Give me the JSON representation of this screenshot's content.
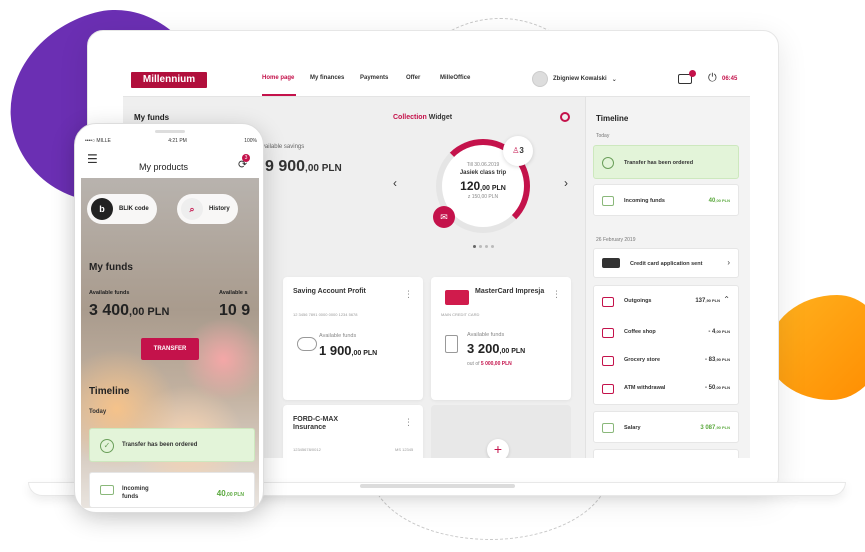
{
  "brand": {
    "logo_text": "Millennium",
    "accent": "#c4124b"
  },
  "topnav": {
    "items": [
      "Home page",
      "My finances",
      "Payments",
      "Offer",
      "MilleOffice"
    ],
    "user_name": "Zbigniew Kowalski",
    "mail_badge": "",
    "time": "06:45"
  },
  "funds": {
    "title": "My funds",
    "available_label": "Available savings",
    "available_value": "9 900",
    "available_decimals": ",00 PLN"
  },
  "widget": {
    "title_accent": "Collection",
    "title_rest": " Widget",
    "date": "Till 30.06.2019",
    "name": "Jasiek class trip",
    "amount": "120",
    "amount_decimals": ",00 PLN",
    "goal": "z 150,00 PLN",
    "participants": "3"
  },
  "cards": [
    {
      "title": "Saving Account Profit",
      "sub": "12 3456 7891 0000 0000 1234 5678",
      "funds_label": "Available funds",
      "value": "1 900",
      "decimals": ",00 PLN"
    },
    {
      "title": "MasterCard Impresja",
      "sub": "MAIN CREDIT CARD",
      "funds_label": "Available funds",
      "value": "3 200",
      "decimals": ",00 PLN",
      "out_of_label": "out of",
      "out_of": "5 000,00 PLN"
    },
    {
      "title": "FORD-C-MAX Insurance",
      "sub": "12345678/0012",
      "sub2": "MS 12345"
    }
  ],
  "timeline": {
    "title": "Timeline",
    "today": "Today",
    "date2": "26 February 2019",
    "items": [
      {
        "text": "Transfer has been ordered"
      },
      {
        "text": "Incoming funds",
        "amount": "40",
        "decimals": ",00 PLN"
      },
      {
        "text": "Credit card application sent"
      },
      {
        "text": "Outgoings",
        "amount": "137",
        "decimals": ",90 PLN"
      },
      {
        "text": "Coffee shop",
        "amount": "- 4",
        "decimals": ",00 PLN"
      },
      {
        "text": "Grocery store",
        "amount": "- 83",
        "decimals": ",90 PLN"
      },
      {
        "text": "ATM withdrawal",
        "amount": "- 50",
        "decimals": ",00 PLN"
      },
      {
        "text": "Salary",
        "amount": "3 087",
        "decimals": ",90 PLN"
      }
    ]
  },
  "phone": {
    "carrier": "••••○ MILLE",
    "clock": "4:21 PM",
    "battery": "100%",
    "title": "My products",
    "bell_badge": "3",
    "blik_label": "BLIK code",
    "history_label": "History",
    "funds_title": "My funds",
    "avail_label": "Available funds",
    "avail_label2": "Available s",
    "avail_value": "3 400",
    "avail_decimals": ",00 PLN",
    "avail_value2": "10 9",
    "transfer_label": "TRANSFER",
    "timeline_title": "Timeline",
    "today": "Today",
    "item1": "Transfer has been ordered",
    "item2": "Incoming funds",
    "item2_amount": "40",
    "item2_decimals": ",00 PLN"
  }
}
